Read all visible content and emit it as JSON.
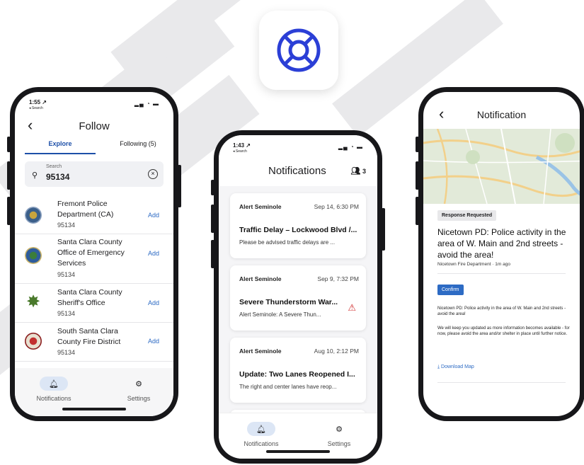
{
  "colors": {
    "accent": "#2d6bc4",
    "brand_icon": "#2b3fd6"
  },
  "app_icon": {
    "icon": "lifebuoy-icon"
  },
  "phone_follow": {
    "status": {
      "time": "1:55 ↗",
      "back_label": "◂ Search",
      "icons": "▂▄ ◔ ▬"
    },
    "title": "Follow",
    "tabs": [
      "Explore",
      "Following (5)"
    ],
    "search": {
      "label": "Search",
      "value": "95134"
    },
    "results": [
      {
        "name": "Fremont Police Department (CA)",
        "zip": "95134",
        "action": "Add",
        "icon": "police-badge-icon"
      },
      {
        "name": "Santa Clara County Office of Emergency Services",
        "zip": "95134",
        "action": "Add",
        "icon": "county-seal-icon"
      },
      {
        "name": "Santa Clara County Sheriff's Office",
        "zip": "95134",
        "action": "Add",
        "icon": "sheriff-star-icon"
      },
      {
        "name": "South Santa Clara County Fire District",
        "zip": "95134",
        "action": "Add",
        "icon": "fire-district-icon"
      }
    ],
    "tabbar": {
      "notifications": "Notifications",
      "settings": "Settings"
    }
  },
  "phone_notifications": {
    "status": {
      "time": "1:43 ↗",
      "back_label": "◂ Search",
      "icons": "▂▄ ◔ ▬"
    },
    "title": "Notifications",
    "group_count": "3",
    "cards": [
      {
        "source": "Alert Seminole",
        "date": "Sep 14, 6:30 PM",
        "headline": "Traffic Delay – Lockwood Blvd /...",
        "body": "Please be advised traffic delays are ...",
        "warning": false
      },
      {
        "source": "Alert Seminole",
        "date": "Sep 9, 7:32 PM",
        "headline": "Severe Thunderstorm War...",
        "body": "Alert Seminole: A Severe Thun...",
        "warning": true
      },
      {
        "source": "Alert Seminole",
        "date": "Aug 10, 2:12 PM",
        "headline": "Update: Two Lanes Reopened I...",
        "body": "The right and center lanes have reop...",
        "warning": false
      }
    ],
    "tabbar": {
      "notifications": "Notifications",
      "settings": "Settings"
    }
  },
  "phone_detail": {
    "title": "Notification",
    "badge": "Response Requested",
    "headline": "Nicetown PD: Police activity in the area of W. Main and 2nd streets - avoid the area!",
    "meta": "Nicetown Fire Department · 1m ago",
    "confirm": "Confirm",
    "body1": "Nicetown PD: Police activity in the area of W. Main and 2nd streets - avoid the area!",
    "body2": "We will keep you updated as more information becomes available - for now, please avoid the area and/or shelter in place until further notice.",
    "download": "⤓ Download Map"
  }
}
